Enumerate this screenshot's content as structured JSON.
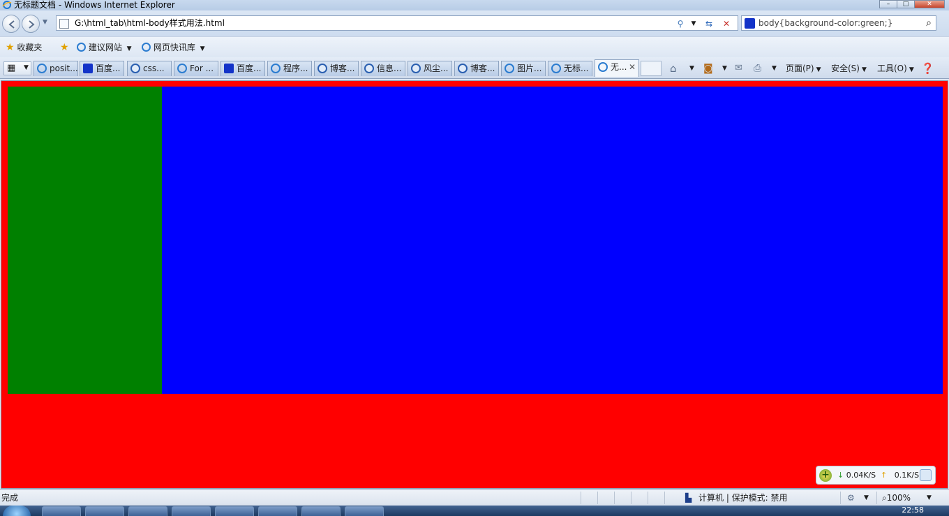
{
  "window": {
    "title": "无标题文档 - Windows Internet Explorer",
    "buttons": [
      "–",
      "□",
      "✕"
    ]
  },
  "nav": {
    "url": "G:\\html_tab\\html-body样式用法.html",
    "search_text": "body{background-color:green;}"
  },
  "favorites": {
    "label": "收藏夹",
    "items": [
      {
        "label": "建议网站"
      },
      {
        "label": "网页快讯库"
      }
    ]
  },
  "tabs": [
    {
      "label": "posit...",
      "icon": "ie-icon"
    },
    {
      "label": "百度...",
      "icon": "baidu-paw-icon"
    },
    {
      "label": "css...",
      "icon": "blog-icon"
    },
    {
      "label": "For ...",
      "icon": "ie-icon"
    },
    {
      "label": "百度...",
      "icon": "baidu-paw-icon"
    },
    {
      "label": "程序...",
      "icon": "ie-icon"
    },
    {
      "label": "博客...",
      "icon": "blog-icon"
    },
    {
      "label": "信息...",
      "icon": "blog-icon"
    },
    {
      "label": "风尘...",
      "icon": "blog-icon"
    },
    {
      "label": "博客...",
      "icon": "blog-icon"
    },
    {
      "label": "图片...",
      "icon": "ie-icon"
    },
    {
      "label": "无标...",
      "icon": "ie-icon"
    },
    {
      "label": "无...",
      "icon": "ie-icon",
      "active": true
    }
  ],
  "commands": {
    "page": "页面(P)",
    "safety": "安全(S)",
    "tools": "工具(O)"
  },
  "content": {
    "colors": {
      "body": "#ff0000",
      "left_box": "#008000",
      "right_box": "#0000ff"
    }
  },
  "speed": {
    "down": "0.04K/S",
    "up": "0.1K/S"
  },
  "status": {
    "text": "完成",
    "zone": "计算机 | 保护模式: 禁用",
    "zoom": "100%"
  },
  "taskbar": {
    "time": "22:58"
  }
}
